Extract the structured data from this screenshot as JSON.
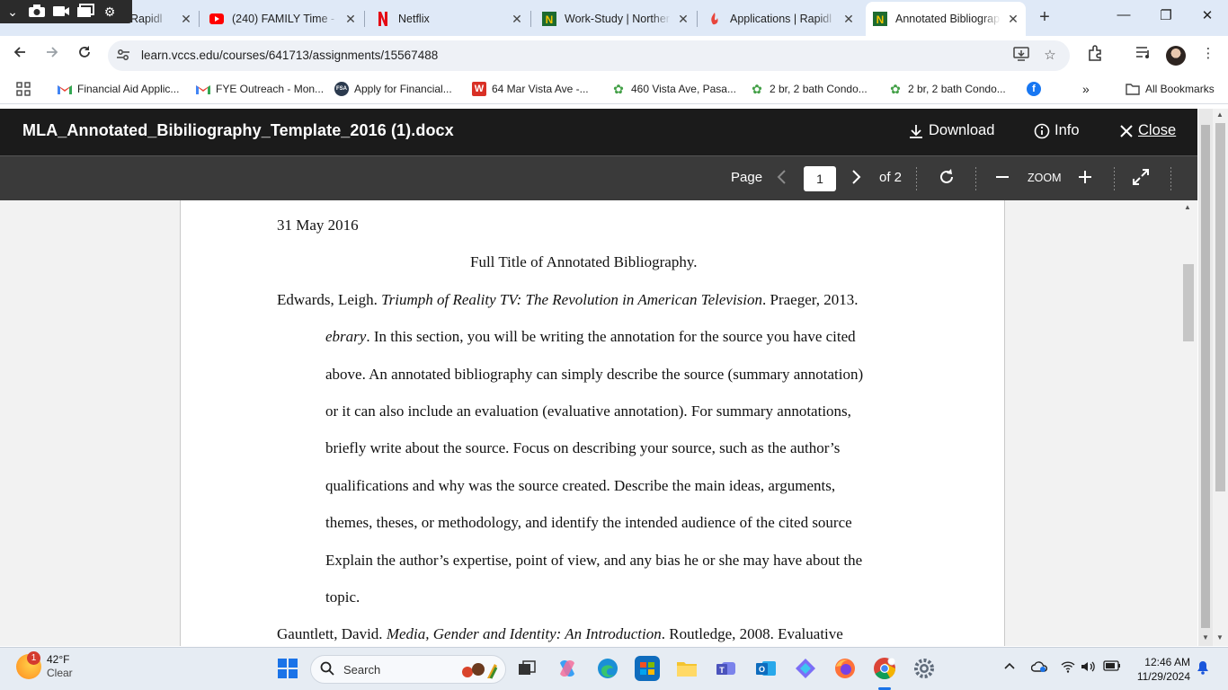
{
  "browser": {
    "tabs": [
      {
        "title": "Applications | Rapidly",
        "icon": "rapidly-icon",
        "visible_label": "Rapidl"
      },
      {
        "title": "(240) FAMILY Time - D",
        "icon": "youtube-icon"
      },
      {
        "title": "Netflix",
        "icon": "netflix-icon"
      },
      {
        "title": "Work-Study | Norther",
        "icon": "n-green-icon"
      },
      {
        "title": "Applications | Rapidl",
        "icon": "rapidly-icon"
      },
      {
        "title": "Annotated Bibliograp",
        "icon": "n-green-icon",
        "active": true
      }
    ],
    "url": "learn.vccs.edu/courses/641713/assignments/15567488",
    "bookmarks": [
      {
        "label": "Financial Aid Applic...",
        "icon": "gmail-icon"
      },
      {
        "label": "FYE Outreach - Mon...",
        "icon": "gmail-icon"
      },
      {
        "label": "Apply for Financial...",
        "icon": "fsa-icon"
      },
      {
        "label": "64 Mar Vista Ave -...",
        "icon": "w-icon"
      },
      {
        "label": "460 Vista Ave, Pasa...",
        "icon": "redfin-icon"
      },
      {
        "label": "2 br, 2 bath Condo...",
        "icon": "redfin-icon"
      },
      {
        "label": "2 br, 2 bath Condo...",
        "icon": "redfin-icon"
      }
    ],
    "all_bookmarks_label": "All Bookmarks"
  },
  "viewer": {
    "filename": "MLA_Annotated_Bibiliography_Template_2016 (1).docx",
    "download_label": "Download",
    "info_label": "Info",
    "close_label": "Close",
    "page_label": "Page",
    "page_value": "1",
    "page_total": "of 2",
    "zoom_label": "ZOOM"
  },
  "document": {
    "date": "31 May 2016",
    "title": "Full Title of Annotated Bibliography.",
    "entry1_author": "Edwards, Leigh. ",
    "entry1_work": "Triumph of Reality TV: The Revolution in American Television",
    "entry1_pub": ". Praeger, 2013.",
    "entry1_db": "ebrary",
    "entry1_l1_rest": ". In this section, you will be writing the annotation for the source you have cited",
    "entry1_lines": [
      "above. An annotated bibliography can simply describe the source (summary annotation)",
      "or it can also include an evaluation (evaluative annotation). For summary annotations,",
      "briefly write about the source. Focus on describing your source, such as the author’s",
      "qualifications and why was the source created. Describe the main ideas, arguments,",
      "themes, theses, or methodology, and identify the intended audience of the cited source",
      "Explain the author’s expertise, point of view, and any bias he or she may have about the",
      "topic."
    ],
    "entry2_author": "Gauntlett, David. ",
    "entry2_work": "Media, Gender and Identity: An Introduction",
    "entry2_pub": ". Routledge, 2008. Evaluative"
  },
  "taskbar": {
    "temperature": "42°F",
    "condition": "Clear",
    "weather_badge": "1",
    "search_label": "Search",
    "time": "12:46 AM",
    "date": "11/29/2024"
  },
  "colors": {
    "tabstrip": "#dfe9f7",
    "viewer_header": "#1b1b1b",
    "viewer_toolbar": "#3a3a3a",
    "accent": "#1a73e8"
  }
}
